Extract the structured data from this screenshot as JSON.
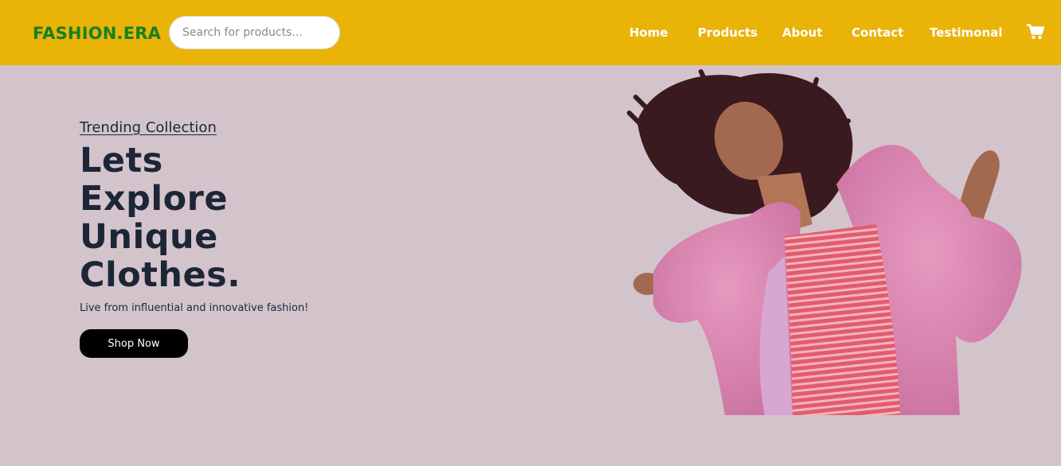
{
  "brand": {
    "name": "FASHION.ERA",
    "color": "#17801f"
  },
  "header": {
    "background": "#e9b308"
  },
  "search": {
    "placeholder": "Search for products..."
  },
  "nav": {
    "items": [
      {
        "label": "Home"
      },
      {
        "label": "Products"
      },
      {
        "label": "About"
      },
      {
        "label": "Contact"
      },
      {
        "label": "Testimonal"
      }
    ],
    "cart_icon": "shopping-cart-icon"
  },
  "hero": {
    "subtitle": "Trending Collection",
    "title_lines": [
      "Lets",
      "Explore",
      "Unique",
      "Clothes."
    ],
    "description": "Live from influential and innovative fashion!",
    "cta_label": "Shop Now",
    "background": "#d3c4cc",
    "image": "woman-in-pink-fur-coat-dancing"
  }
}
